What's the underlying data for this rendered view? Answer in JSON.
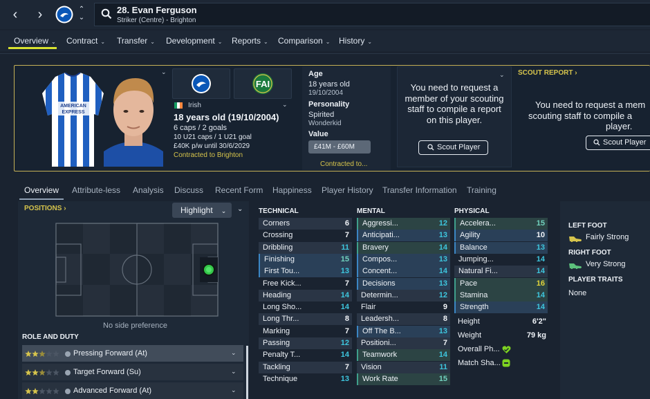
{
  "header": {
    "player_name": "28. Evan Ferguson",
    "player_position": "Striker (Centre) - Brighton"
  },
  "main_nav": [
    {
      "label": "Overview"
    },
    {
      "label": "Contract"
    },
    {
      "label": "Transfer"
    },
    {
      "label": "Development"
    },
    {
      "label": "Reports"
    },
    {
      "label": "Comparison"
    },
    {
      "label": "History"
    }
  ],
  "profile": {
    "nationality": "Irish",
    "age_line": "18 years old (19/10/2004)",
    "caps": "6 caps / 2 goals",
    "u21": "10 U21 caps / 1 U21 goal",
    "wage": "£40K p/w until 30/6/2029",
    "contracted": "Contracted to Brighton",
    "club_badge_text": "FAI"
  },
  "age_panel": {
    "age_label": "Age",
    "age_value": "18 years old",
    "dob": "19/10/2004",
    "personality_label": "Personality",
    "personality_value": "Spirited",
    "media_value": "Wonderkid",
    "value_label": "Value",
    "value_range": "£41M - £60M",
    "contracted": "Contracted to..."
  },
  "scout": {
    "message1": "You need to request a member of your scouting staff to compile a report on this player.",
    "button1": "Scout Player",
    "report_heading": "SCOUT REPORT",
    "message2_line1": "You need to request a mem",
    "message2_line2": "scouting staff to compile a",
    "message2_line3": "player.",
    "button2": "Scout Player"
  },
  "subtabs": [
    {
      "label": "Overview"
    },
    {
      "label": "Attribute-less"
    },
    {
      "label": "Analysis"
    },
    {
      "label": "Discuss"
    },
    {
      "label": "Recent Form"
    },
    {
      "label": "Happiness"
    },
    {
      "label": "Player History"
    },
    {
      "label": "Transfer Information"
    },
    {
      "label": "Training"
    }
  ],
  "positions": {
    "heading": "POSITIONS",
    "highlight_label": "Highlight",
    "no_side": "No side preference",
    "role_heading": "ROLE AND DUTY",
    "roles": [
      {
        "label": "Pressing Forward (At)",
        "stars": 2.5
      },
      {
        "label": "Target Forward (Su)",
        "stars": 2.5
      },
      {
        "label": "Advanced Forward (At)",
        "stars": 2
      }
    ]
  },
  "attributes": {
    "technical_heading": "TECHNICAL",
    "mental_heading": "MENTAL",
    "physical_heading": "PHYSICAL",
    "technical": [
      {
        "name": "Corners",
        "value": "6",
        "color": "#f1f4f8",
        "hl": ""
      },
      {
        "name": "Crossing",
        "value": "7",
        "color": "#f1f4f8",
        "hl": ""
      },
      {
        "name": "Dribbling",
        "value": "11",
        "color": "#3ec6de",
        "hl": ""
      },
      {
        "name": "Finishing",
        "value": "15",
        "color": "#71d2be",
        "hl": "blue"
      },
      {
        "name": "First Tou...",
        "value": "13",
        "color": "#3ec6de",
        "hl": "blue"
      },
      {
        "name": "Free Kick...",
        "value": "7",
        "color": "#f1f4f8",
        "hl": ""
      },
      {
        "name": "Heading",
        "value": "14",
        "color": "#3ec6de",
        "hl": ""
      },
      {
        "name": "Long Sho...",
        "value": "14",
        "color": "#3ec6de",
        "hl": ""
      },
      {
        "name": "Long Thr...",
        "value": "8",
        "color": "#f1f4f8",
        "hl": ""
      },
      {
        "name": "Marking",
        "value": "7",
        "color": "#f1f4f8",
        "hl": ""
      },
      {
        "name": "Passing",
        "value": "12",
        "color": "#3ec6de",
        "hl": ""
      },
      {
        "name": "Penalty T...",
        "value": "14",
        "color": "#3ec6de",
        "hl": ""
      },
      {
        "name": "Tackling",
        "value": "7",
        "color": "#f1f4f8",
        "hl": ""
      },
      {
        "name": "Technique",
        "value": "13",
        "color": "#3ec6de",
        "hl": ""
      }
    ],
    "mental": [
      {
        "name": "Aggressi...",
        "value": "12",
        "color": "#3ec6de",
        "hl": "green"
      },
      {
        "name": "Anticipati...",
        "value": "13",
        "color": "#3ec6de",
        "hl": "blue"
      },
      {
        "name": "Bravery",
        "value": "14",
        "color": "#3ec6de",
        "hl": "green"
      },
      {
        "name": "Compos...",
        "value": "13",
        "color": "#3ec6de",
        "hl": "blue"
      },
      {
        "name": "Concent...",
        "value": "14",
        "color": "#3ec6de",
        "hl": "blue"
      },
      {
        "name": "Decisions",
        "value": "13",
        "color": "#3ec6de",
        "hl": "blue"
      },
      {
        "name": "Determin...",
        "value": "12",
        "color": "#3ec6de",
        "hl": ""
      },
      {
        "name": "Flair",
        "value": "9",
        "color": "#f1f4f8",
        "hl": ""
      },
      {
        "name": "Leadersh...",
        "value": "8",
        "color": "#f1f4f8",
        "hl": ""
      },
      {
        "name": "Off The B...",
        "value": "13",
        "color": "#3ec6de",
        "hl": "blue"
      },
      {
        "name": "Positioni...",
        "value": "7",
        "color": "#f1f4f8",
        "hl": ""
      },
      {
        "name": "Teamwork",
        "value": "14",
        "color": "#3ec6de",
        "hl": "green"
      },
      {
        "name": "Vision",
        "value": "11",
        "color": "#3ec6de",
        "hl": ""
      },
      {
        "name": "Work Rate",
        "value": "15",
        "color": "#71d2be",
        "hl": "green"
      }
    ],
    "physical": [
      {
        "name": "Accelera...",
        "value": "15",
        "color": "#71d2be",
        "hl": "green"
      },
      {
        "name": "Agility",
        "value": "10",
        "color": "#f1f4f8",
        "hl": "blue"
      },
      {
        "name": "Balance",
        "value": "13",
        "color": "#3ec6de",
        "hl": "blue"
      },
      {
        "name": "Jumping...",
        "value": "14",
        "color": "#3ec6de",
        "hl": ""
      },
      {
        "name": "Natural Fi...",
        "value": "14",
        "color": "#3ec6de",
        "hl": ""
      },
      {
        "name": "Pace",
        "value": "16",
        "color": "#e2d63a",
        "hl": "green"
      },
      {
        "name": "Stamina",
        "value": "14",
        "color": "#3ec6de",
        "hl": "green"
      },
      {
        "name": "Strength",
        "value": "14",
        "color": "#3ec6de",
        "hl": "blue"
      }
    ],
    "extra": {
      "height_label": "Height",
      "height_value": "6'2\"",
      "weight_label": "Weight",
      "weight_value": "79 kg",
      "overall_label": "Overall Ph...",
      "match_label": "Match Sha..."
    }
  },
  "foot": {
    "left_heading": "LEFT FOOT",
    "left_value": "Fairly Strong",
    "right_heading": "RIGHT FOOT",
    "right_value": "Very Strong",
    "traits_heading": "PLAYER TRAITS",
    "traits_value": "None"
  },
  "colors": {
    "accent_yellow": "#d8e230",
    "gold": "#d6c44c",
    "green_status": "#7ed321"
  }
}
